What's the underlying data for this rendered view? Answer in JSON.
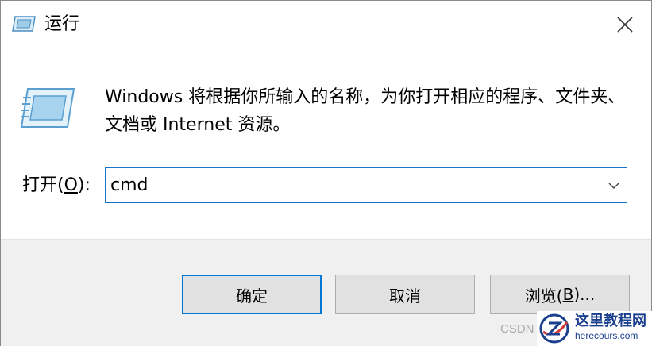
{
  "window": {
    "title": "运行",
    "title_icon": "run-icon",
    "close_icon": "close-icon"
  },
  "body": {
    "description": "Windows 将根据你所输入的名称，为你打开相应的程序、文件夹、文档或 Internet 资源。"
  },
  "open_field": {
    "label_prefix": "打开(",
    "label_mnemonic": "O",
    "label_suffix": "):",
    "value": "cmd"
  },
  "buttons": {
    "ok": "确定",
    "cancel": "取消",
    "browse_prefix": "浏览(",
    "browse_mnemonic": "B",
    "browse_suffix": ")..."
  },
  "watermark": {
    "text": "CSDN",
    "site_name": "这里教程网",
    "site_url": "herecours.com"
  },
  "colors": {
    "accent": "#0078d7",
    "footer_bg": "#f0f0f0"
  }
}
